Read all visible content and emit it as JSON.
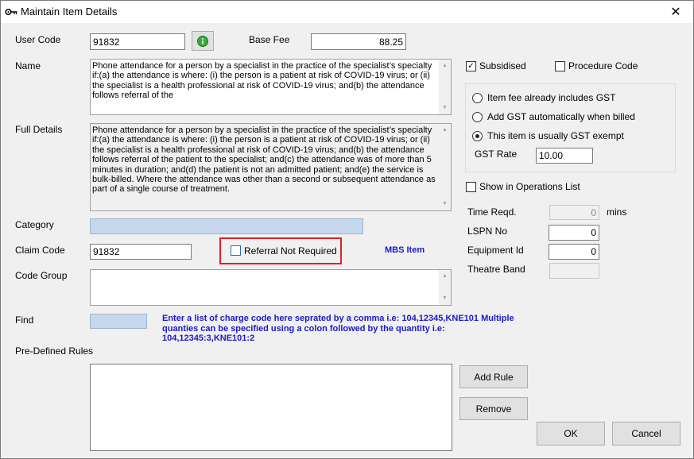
{
  "window": {
    "title": "Maintain Item Details",
    "close_glyph": "✕"
  },
  "fields": {
    "user_code": {
      "label": "User Code",
      "value": "91832"
    },
    "base_fee": {
      "label": "Base Fee",
      "value": "88.25"
    },
    "name": {
      "label": "Name",
      "value": "Phone attendance for a person by a specialist in the practice of the specialist’s specialty if:(a) the attendance is where: (i) the person is a patient at risk of COVID-19 virus; or (ii) the specialist is a health professional at risk of COVID-19 virus; and(b) the attendance follows referral of the"
    },
    "full_details": {
      "label": "Full Details",
      "value": "Phone attendance for a person by a specialist in the practice of the specialist’s specialty if:(a) the attendance is where: (i) the person is a patient at risk of COVID-19 virus; or (ii) the specialist is a health professional at risk of COVID-19 virus; and(b) the attendance follows referral of the patient to the specialist; and(c) the attendance was of more than 5 minutes in duration; and(d) the patient is not an admitted patient; and(e) the service is bulk-billed. Where the attendance was other than a second or subsequent attendance as part of a single course of treatment."
    },
    "category": {
      "label": "Category",
      "value": ""
    },
    "claim_code": {
      "label": "Claim Code",
      "value": "91832"
    },
    "referral_not_required": {
      "label": "Referral Not Required",
      "checked": false
    },
    "mbs_item": {
      "label": "MBS Item"
    },
    "code_group": {
      "label": "Code Group",
      "value": ""
    },
    "find": {
      "label": "Find",
      "value": "",
      "hint": "Enter a list of charge code here seprated by a comma i.e: 104,12345,KNE101 Multiple quanties can be specified using a colon followed by the quantity i.e: 104,12345:3,KNE101:2"
    },
    "pre_defined_rules": {
      "label": "Pre-Defined Rules",
      "value": ""
    }
  },
  "right": {
    "subsidised": {
      "label": "Subsidised",
      "checked": true,
      "mark": "✓"
    },
    "procedure_code": {
      "label": "Procedure Code",
      "checked": false
    },
    "gst_options": [
      {
        "label": "Item fee already includes GST",
        "selected": false
      },
      {
        "label": "Add GST automatically when billed",
        "selected": false
      },
      {
        "label": "This item is usually GST exempt",
        "selected": true
      }
    ],
    "gst_rate": {
      "label": "GST Rate",
      "value": "10.00"
    },
    "show_in_operations": {
      "label": "Show in Operations List",
      "checked": false
    },
    "time_reqd": {
      "label": "Time Reqd.",
      "value": "0",
      "unit": "mins"
    },
    "lspn_no": {
      "label": "LSPN No",
      "value": "0"
    },
    "equipment_id": {
      "label": "Equipment Id",
      "value": "0"
    },
    "theatre_band": {
      "label": "Theatre Band",
      "value": ""
    }
  },
  "buttons": {
    "add_rule": "Add Rule",
    "remove": "Remove",
    "ok": "OK",
    "cancel": "Cancel"
  },
  "icons": {
    "app": "key-icon",
    "info": "info-green-icon",
    "scroll_up": "▲",
    "scroll_down": "▼"
  },
  "colors": {
    "highlight": "#e0202a",
    "hint_text": "#1a1acc",
    "selected_field": "#c6d7ee"
  }
}
